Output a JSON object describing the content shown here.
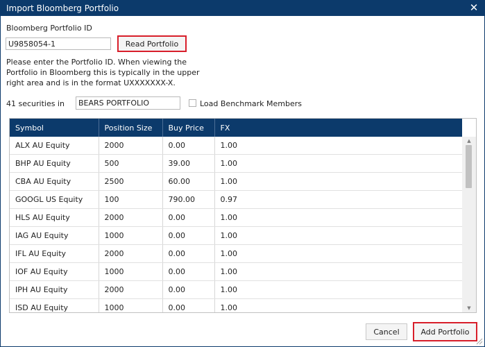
{
  "dialog": {
    "title": "Import Bloomberg Portfolio",
    "close_icon": "close-icon"
  },
  "portfolio": {
    "id_label": "Bloomberg Portfolio ID",
    "id_value": "U9858054-1",
    "read_label": "Read Portfolio",
    "help_text": "Please enter the Portfolio ID. When viewing the Portfolio in Bloomberg this is typically in the upper right area and is in the format UXXXXXXX-X."
  },
  "securities": {
    "count_label": "41 securities in",
    "name_value": "BEARS PORTFOLIO",
    "benchmark_label": "Load Benchmark Members",
    "benchmark_checked": false
  },
  "table": {
    "columns": [
      "Symbol",
      "Position Size",
      "Buy Price",
      "FX"
    ],
    "rows": [
      [
        "ALX AU Equity",
        "2000",
        "0.00",
        "1.00"
      ],
      [
        "BHP AU Equity",
        "500",
        "39.00",
        "1.00"
      ],
      [
        "CBA AU Equity",
        "2500",
        "60.00",
        "1.00"
      ],
      [
        "GOOGL US Equity",
        "100",
        "790.00",
        "0.97"
      ],
      [
        "HLS AU Equity",
        "2000",
        "0.00",
        "1.00"
      ],
      [
        "IAG AU Equity",
        "1000",
        "0.00",
        "1.00"
      ],
      [
        "IFL AU Equity",
        "2000",
        "0.00",
        "1.00"
      ],
      [
        "IOF AU Equity",
        "1000",
        "0.00",
        "1.00"
      ],
      [
        "IPH AU Equity",
        "2000",
        "0.00",
        "1.00"
      ],
      [
        "ISD AU Equity",
        "1000",
        "0.00",
        "1.00"
      ]
    ]
  },
  "footer": {
    "cancel_label": "Cancel",
    "add_label": "Add Portfolio"
  },
  "colors": {
    "title_bar": "#0c3a6b",
    "header": "#0c3a6b",
    "highlight_border": "#d81e2a"
  }
}
